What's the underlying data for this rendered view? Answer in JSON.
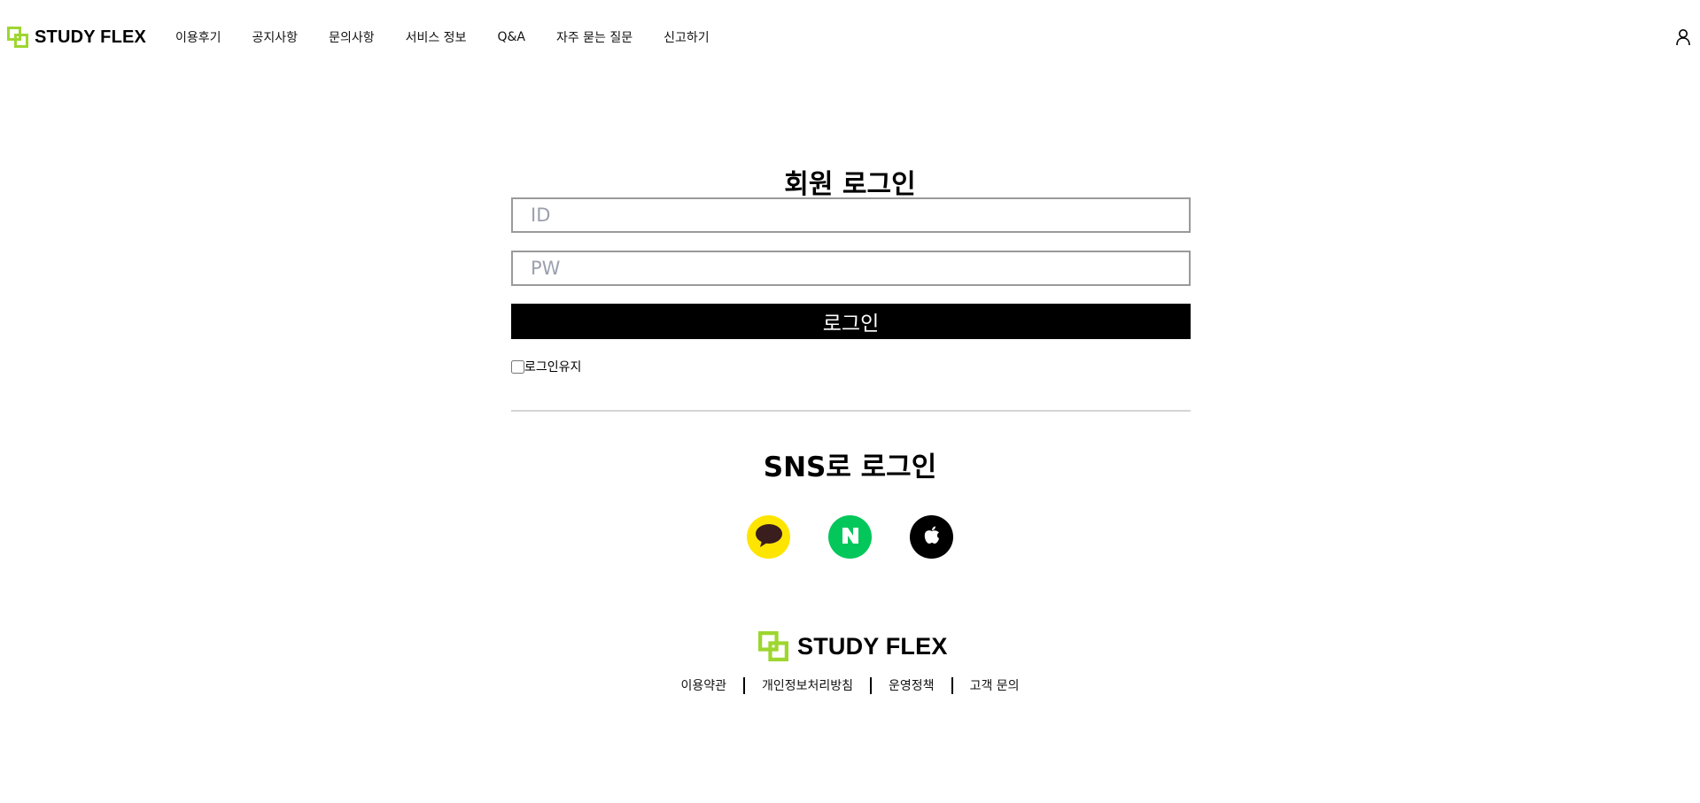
{
  "brand": {
    "name": "STUDY FLEX",
    "accent": "#9ed630"
  },
  "nav": {
    "items": [
      {
        "label": "이용후기"
      },
      {
        "label": "공지사항"
      },
      {
        "label": "문의사항"
      },
      {
        "label": "서비스 정보"
      },
      {
        "label": "Q&A"
      },
      {
        "label": "자주 묻는 질문"
      },
      {
        "label": "신고하기"
      }
    ],
    "user_icon": "user-icon"
  },
  "login": {
    "title": "회원 로그인",
    "id_placeholder": "ID",
    "pw_placeholder": "PW",
    "submit_label": "로그인",
    "remember_label": "로그인유지"
  },
  "sns": {
    "title": "SNS로 로그인",
    "providers": [
      {
        "name": "kakao",
        "icon": "kakao-talk-icon",
        "color": "#fee500"
      },
      {
        "name": "naver",
        "icon": "naver-n-icon",
        "color": "#03c75a"
      },
      {
        "name": "apple",
        "icon": "apple-icon",
        "color": "#000000"
      }
    ]
  },
  "footer": {
    "brand": "STUDY FLEX",
    "links": [
      {
        "label": "이용약관"
      },
      {
        "label": "개인정보처리방침"
      },
      {
        "label": "운영정책"
      },
      {
        "label": "고객 문의"
      }
    ]
  }
}
